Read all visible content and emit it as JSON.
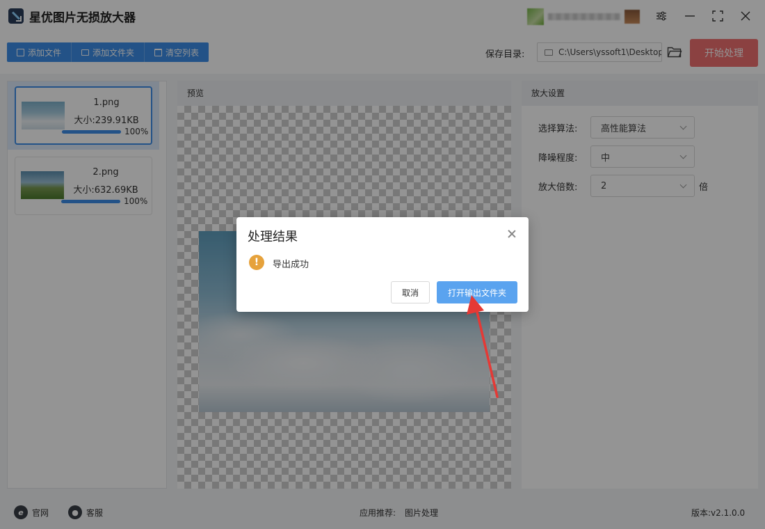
{
  "app": {
    "title": "星优图片无损放大器"
  },
  "window_controls": {
    "settings_icon": "sliders-icon",
    "minimize_icon": "minimize-icon",
    "maximize_icon": "maximize-icon",
    "close_icon": "close-icon"
  },
  "toolbar": {
    "add_file": "添加文件",
    "add_folder": "添加文件夹",
    "clear_list": "清空列表",
    "save_dir_label": "保存目录:",
    "save_dir_value": "C:\\Users\\yssoft1\\Desktop",
    "start": "开始处理"
  },
  "files": [
    {
      "name": "1.png",
      "size": "大小:239.91KB",
      "progress": "100%",
      "progress_value": 1.0
    },
    {
      "name": "2.png",
      "size": "大小:632.69KB",
      "progress": "100%",
      "progress_value": 1.0
    }
  ],
  "preview": {
    "title": "预览"
  },
  "settings": {
    "title": "放大设置",
    "algorithm_label": "选择算法:",
    "algorithm_value": "高性能算法",
    "denoise_label": "降噪程度:",
    "denoise_value": "中",
    "scale_label": "放大倍数:",
    "scale_value": "2",
    "scale_suffix": "倍"
  },
  "footer": {
    "website": "官网",
    "support": "客服",
    "recommend_label": "应用推荐:",
    "recommend_value": "图片处理",
    "version": "版本:v2.1.0.0"
  },
  "dialog": {
    "title": "处理结果",
    "message": "导出成功",
    "cancel": "取消",
    "open_folder": "打开输出文件夹"
  },
  "colors": {
    "accent": "#3d8ee8",
    "start_button": "#f07070",
    "dialog_primary": "#5aa3ef",
    "warning": "#e6a23c",
    "arrow": "#e53935"
  }
}
